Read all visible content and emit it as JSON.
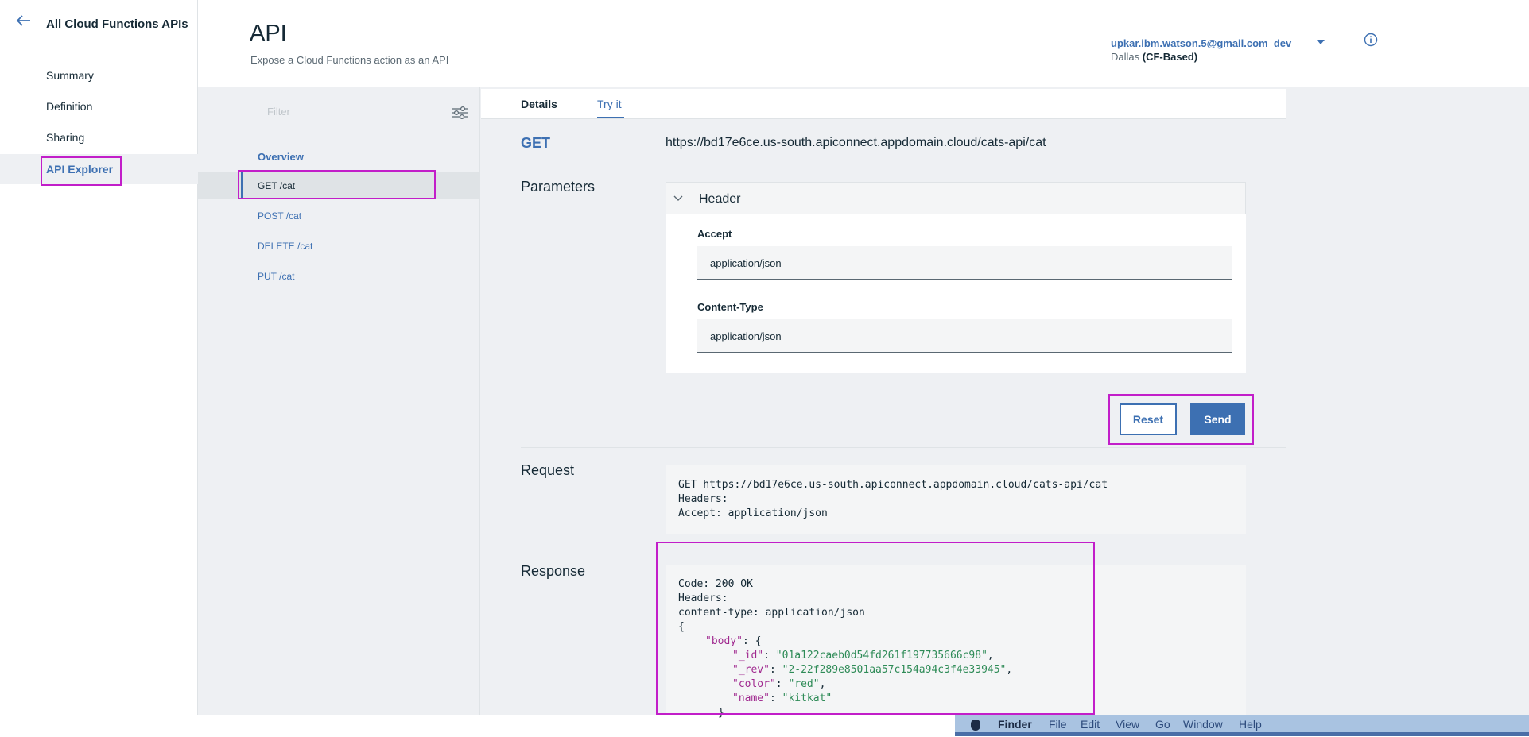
{
  "sidebar": {
    "back_title": "All Cloud Functions APIs",
    "items": [
      {
        "label": "Summary"
      },
      {
        "label": "Definition"
      },
      {
        "label": "Sharing"
      },
      {
        "label": "API Explorer"
      }
    ]
  },
  "header": {
    "title": "API",
    "subtitle": "Expose a Cloud Functions action as an API",
    "account": "upkar.ibm.watson.5@gmail.com_dev",
    "region_prefix": "Dallas",
    "region_suffix": "(CF-Based)"
  },
  "explorer": {
    "filter_placeholder": "Filter",
    "overview_label": "Overview",
    "endpoints": [
      {
        "label": "GET /cat"
      },
      {
        "label": "POST /cat"
      },
      {
        "label": "DELETE /cat"
      },
      {
        "label": "PUT /cat"
      }
    ]
  },
  "tabs": [
    {
      "label": "Details"
    },
    {
      "label": "Try it"
    }
  ],
  "tryit": {
    "method": "GET",
    "url": "https://bd17e6ce.us-south.apiconnect.appdomain.cloud/cats-api/cat",
    "parameters_label": "Parameters",
    "header_section_label": "Header",
    "fields": [
      {
        "label": "Accept",
        "value": "application/json"
      },
      {
        "label": "Content-Type",
        "value": "application/json"
      }
    ],
    "reset_label": "Reset",
    "send_label": "Send",
    "request_label": "Request",
    "request_lines": [
      "GET https://bd17e6ce.us-south.apiconnect.appdomain.cloud/cats-api/cat",
      "Headers:",
      "Accept: application/json"
    ],
    "response_label": "Response",
    "response": {
      "code_line": "Code: 200 OK",
      "headers_line": "Headers:",
      "content_type_line": "content-type: application/json",
      "open_brace": "{",
      "body_key": "\"body\"",
      "body_open": ": {",
      "id_key": "\"_id\"",
      "id_value": "\"01a122caeb0d54fd261f197735666c98\"",
      "rev_key": "\"_rev\"",
      "rev_value": "\"2-22f289e8501aa57c154a94c3f4e33945\"",
      "color_key": "\"color\"",
      "color_value": "\"red\"",
      "name_key": "\"name\"",
      "name_value": "\"kitkat\"",
      "close_brace": "}"
    }
  },
  "finder_menu": {
    "app": "Finder",
    "items": [
      "File",
      "Edit",
      "View",
      "Go",
      "Window",
      "Help"
    ]
  },
  "colors": {
    "accent": "#3d70b2",
    "highlight": "#c21ec9",
    "json_key": "#a0298f",
    "json_string": "#2e8b57"
  }
}
